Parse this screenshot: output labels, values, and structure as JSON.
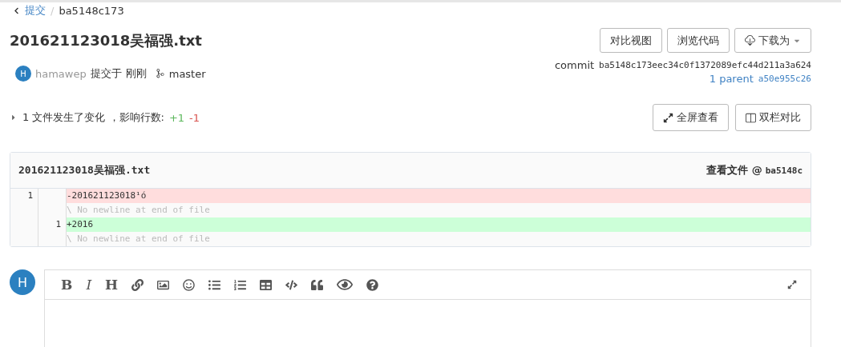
{
  "breadcrumb": {
    "back": "提交",
    "separator": "/",
    "current": "ba5148c173"
  },
  "title": "201621123018吴福强.txt",
  "header_buttons": [
    {
      "label": "对比视图",
      "kind": "plain"
    },
    {
      "label": "浏览代码",
      "kind": "plain"
    },
    {
      "label": "下载为",
      "kind": "download"
    }
  ],
  "author": {
    "avatar": "H",
    "name": "hamawep",
    "action": "提交于",
    "time": "刚刚",
    "branch": "master"
  },
  "commit": {
    "label": "commit",
    "sha": "ba5148c173eec34c0f1372089efc44d211a3a624",
    "parent_label": "1 parent",
    "parent_sha": "a50e955c26"
  },
  "summary": {
    "text": "1 文件发生了变化 ，影响行数:",
    "added": "+1",
    "removed": "-1"
  },
  "view_buttons": [
    {
      "label": "全屏查看",
      "kind": "fullscreen"
    },
    {
      "label": "双栏对比",
      "kind": "split"
    }
  ],
  "diff": {
    "file": "201621123018吴福强.txt",
    "view_label": "查看文件 @",
    "view_sha": "ba5148c",
    "lines": [
      {
        "kind": "del",
        "old": "1",
        "text": "-201621123018¹ó"
      },
      {
        "kind": "note",
        "text": "\\ No newline at end of file"
      },
      {
        "kind": "add",
        "new": "1",
        "text": "+2016"
      },
      {
        "kind": "note",
        "text": "\\ No newline at end of file"
      }
    ]
  },
  "editor": {
    "avatar": "H",
    "tools": [
      "B",
      "I",
      "H"
    ]
  }
}
